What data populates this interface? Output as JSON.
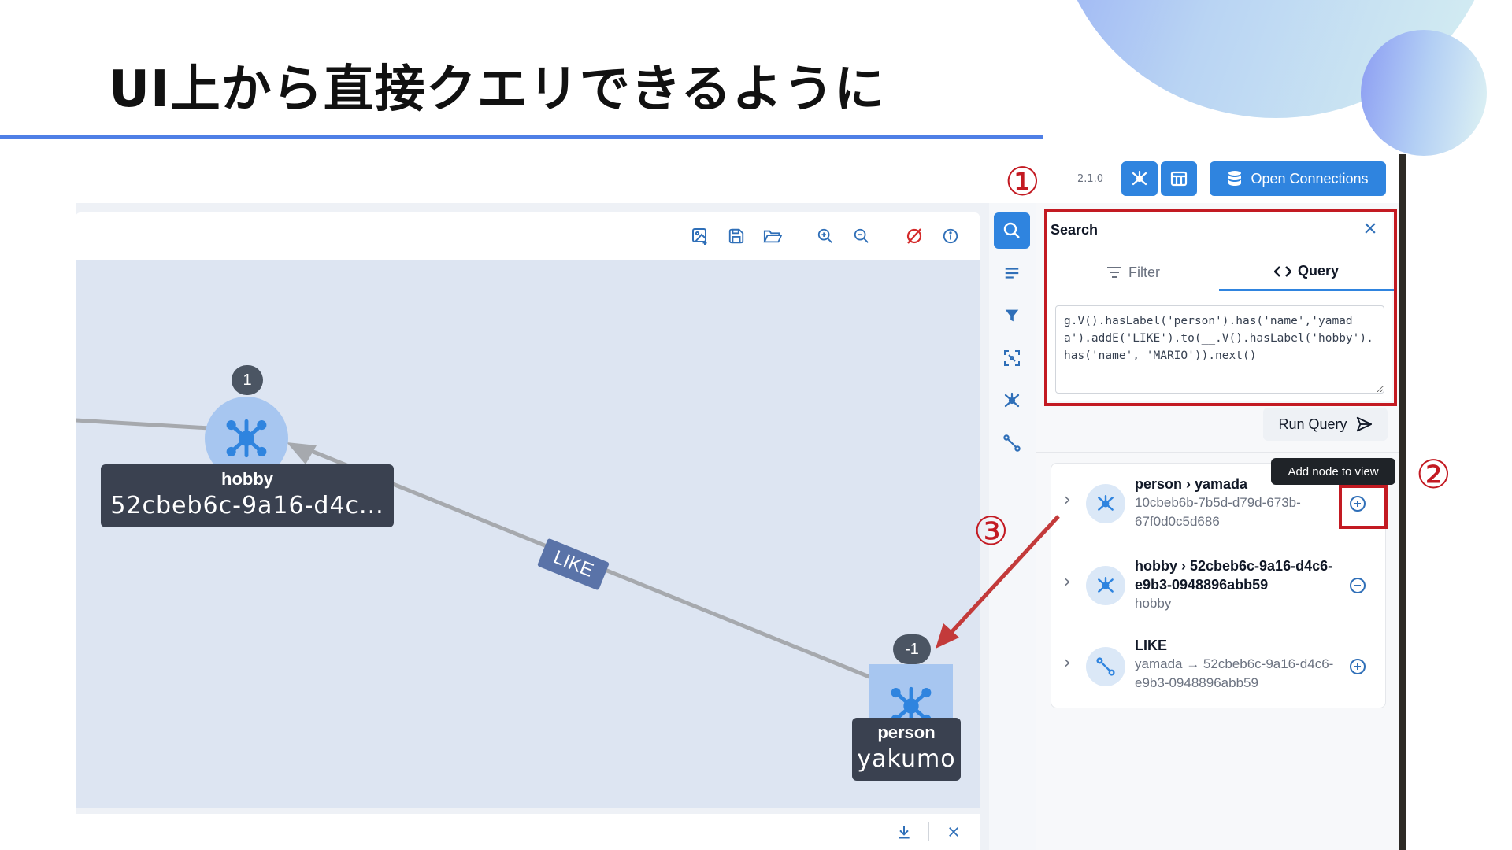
{
  "slide": {
    "title": "UI上から直接クエリできるように"
  },
  "header": {
    "version": "2.1.0",
    "open_connections_label": "Open Connections"
  },
  "graph_toolbar": {
    "icons": [
      "export-image-icon",
      "save-icon",
      "open-folder-icon",
      "zoom-in-icon",
      "zoom-out-icon",
      "clear-graph-icon",
      "info-icon"
    ]
  },
  "nav_rail": {
    "items": [
      "search-icon",
      "details-icon",
      "filter-icon",
      "focus-icon",
      "nodes-icon",
      "edges-icon"
    ]
  },
  "search_panel": {
    "title": "Search",
    "tabs": [
      {
        "label": "Filter"
      },
      {
        "label": "Query"
      }
    ],
    "query_text": "g.V().hasLabel('person').has('name','yamada').addE('LIKE').to(__.V().hasLabel('hobby').has('name', 'MARIO')).next()",
    "run_label": "Run Query"
  },
  "tooltip": {
    "text": "Add node to view"
  },
  "results": [
    {
      "title": "person › yamada",
      "subtitle": "10cbeb6b-7b5d-d79d-673b-67f0d0c5d686",
      "icon": "node-icon",
      "action": "add-icon"
    },
    {
      "title": "hobby › 52cbeb6c-9a16-d4c6-e9b3-0948896abb59",
      "subtitle": "hobby",
      "icon": "node-icon",
      "action": "remove-icon"
    },
    {
      "title": "LIKE",
      "subtitle": "yamada → 52cbeb6c-9a16-d4c6-e9b3-0948896abb59",
      "icon": "edge-icon",
      "action": "add-icon"
    }
  ],
  "graph": {
    "nodes": [
      {
        "badge": "1",
        "label": "hobby",
        "value": "52cbeb6c-9a16-d4c..."
      },
      {
        "badge": "-1",
        "label": "person",
        "value": "yakumo"
      }
    ],
    "edge_label": "LIKE"
  },
  "annotations": {
    "m1": "①",
    "m2": "②",
    "m3": "③"
  },
  "colors": {
    "accent": "#2f84df",
    "annotation_red": "#c31a22",
    "title_rule": "#4f7fe6"
  }
}
